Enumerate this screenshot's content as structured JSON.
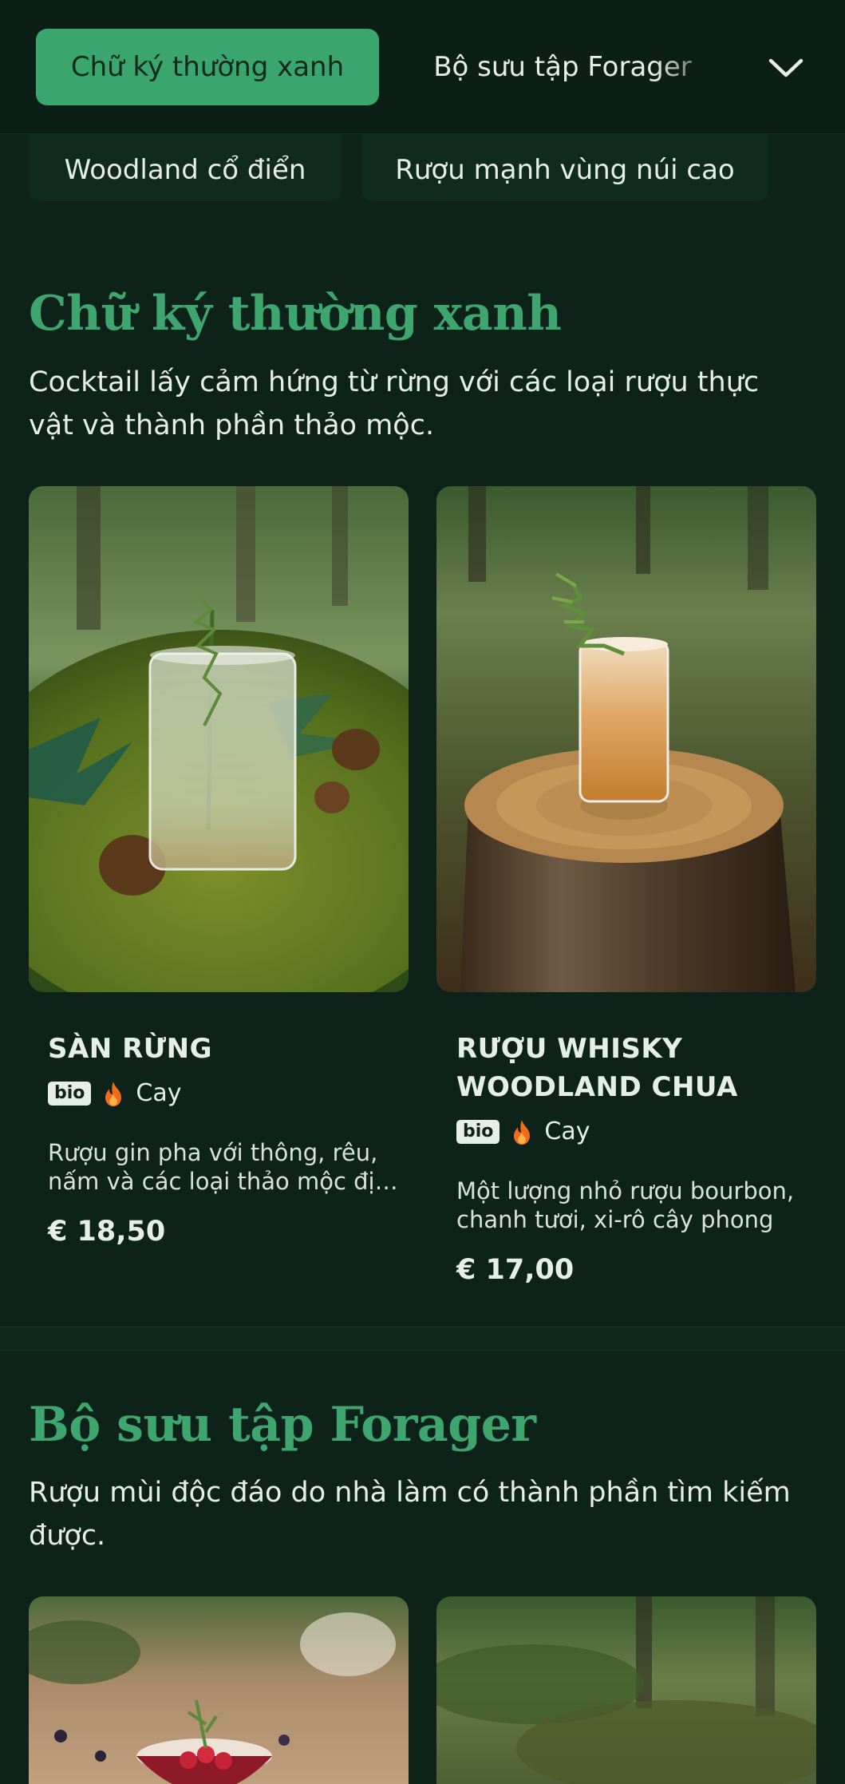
{
  "nav": {
    "active_chip": "Chữ ký thường xanh",
    "second_chip": "Bộ sưu tập Forager",
    "row2": [
      "Woodland cổ điển",
      "Rượu mạnh vùng núi cao"
    ]
  },
  "sections": [
    {
      "title": "Chữ ký thường xanh",
      "description": "Cocktail lấy cảm hứng từ rừng với các loại rượu thực vật và thành phần thảo mộc.",
      "cards": [
        {
          "name": "SÀN RỪNG",
          "badge": "bio",
          "tag": "Cay",
          "description": "Rượu gin pha với thông, rêu, nấm và các loại thảo mộc địa phương",
          "price": "€ 18,50"
        },
        {
          "name": "RƯỢU WHISKY WOODLAND CHUA",
          "badge": "bio",
          "tag": "Cay",
          "description": "Một lượng nhỏ rượu bourbon, chanh tươi, xi-rô cây phong",
          "price": "€ 17,00"
        }
      ]
    },
    {
      "title": "Bộ sưu tập Forager",
      "description": "Rượu mùi độc đáo do nhà làm có thành phần tìm kiếm được."
    }
  ],
  "colors": {
    "background": "#0d2219",
    "accent": "#3aa56d",
    "flame": "#f26a1b"
  },
  "icons": {
    "chevron": "chevron-down-icon",
    "spicy": "flame-icon"
  }
}
